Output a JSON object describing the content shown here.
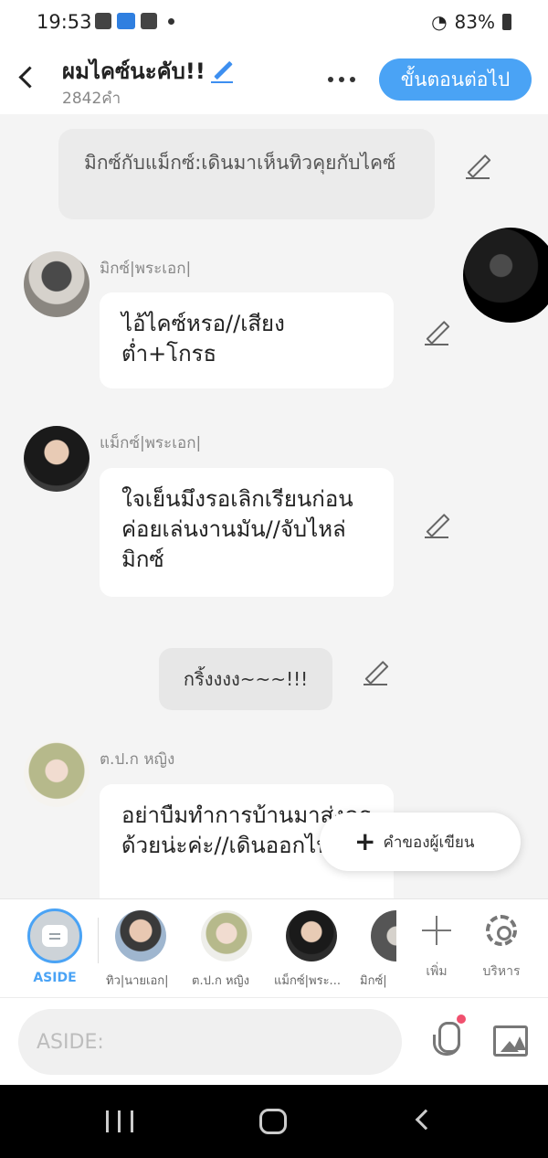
{
  "status": {
    "time": "19:53",
    "battery": "83%"
  },
  "header": {
    "title": "ผมไคซ์นะคับ!!",
    "word_count": "2842คำ",
    "next_button": "ขั้นตอนต่อไป"
  },
  "messages": {
    "narration_1": "มิกซ์กับแม็กซ์:เดินมาเห็นทิวคุยกับไคซ์",
    "msg_1": {
      "speaker": "มิกซ์|พระเอก|",
      "text": "ไอ้ไคซ์หรอ//เสียงต่ำ+โกรธ"
    },
    "msg_2": {
      "speaker": "แม็กซ์|พระเอก|",
      "text": "ใจเย็นมึงรอเลิกเรียนก่อนค่อยเล่นงานมัน//จับไหล่มิกซ์"
    },
    "sound": "กริ้งงงง~~~!!!",
    "msg_3": {
      "speaker": "ต.ป.ก หญิง",
      "text": "อย่าบืมทำการบ้านมาส่งครูด้วยน่ะค่ะ//เดินออกไป"
    }
  },
  "author_button": "คำของผู้เขียน",
  "charbar": {
    "aside_label": "ASIDE",
    "characters": [
      {
        "label": "ทิว|นายเอก|"
      },
      {
        "label": "ต.ป.ก หญิง"
      },
      {
        "label": "แม็กซ์|พระ..."
      },
      {
        "label": "มิกซ์|"
      }
    ],
    "add_label": "เพิ่ม",
    "manage_label": "บริหาร"
  },
  "input": {
    "placeholder": "ASIDE:"
  },
  "colors": {
    "accent": "#4aa3f5",
    "notify_dot": "#f0506e"
  }
}
